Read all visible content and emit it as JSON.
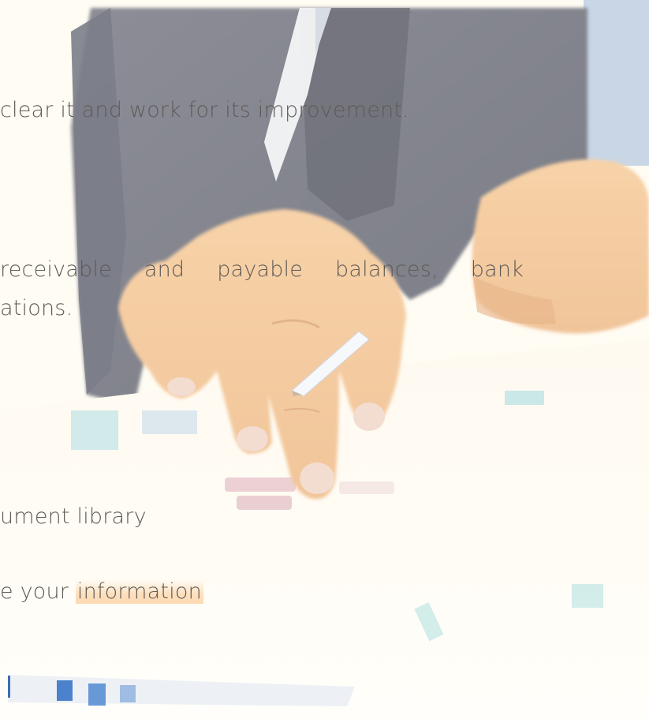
{
  "content": {
    "line1": "clear it and work for its improvement.",
    "line2_words": [
      "receivable",
      "and",
      "payable",
      "balances,",
      "bank"
    ],
    "line3": "ations.",
    "line4": "ument library",
    "line5_prefix": "e your ",
    "line5_highlight": "information"
  },
  "colors": {
    "text": "#5e5a57",
    "background": "#fffdf6",
    "highlight": "#fdd6aa"
  }
}
